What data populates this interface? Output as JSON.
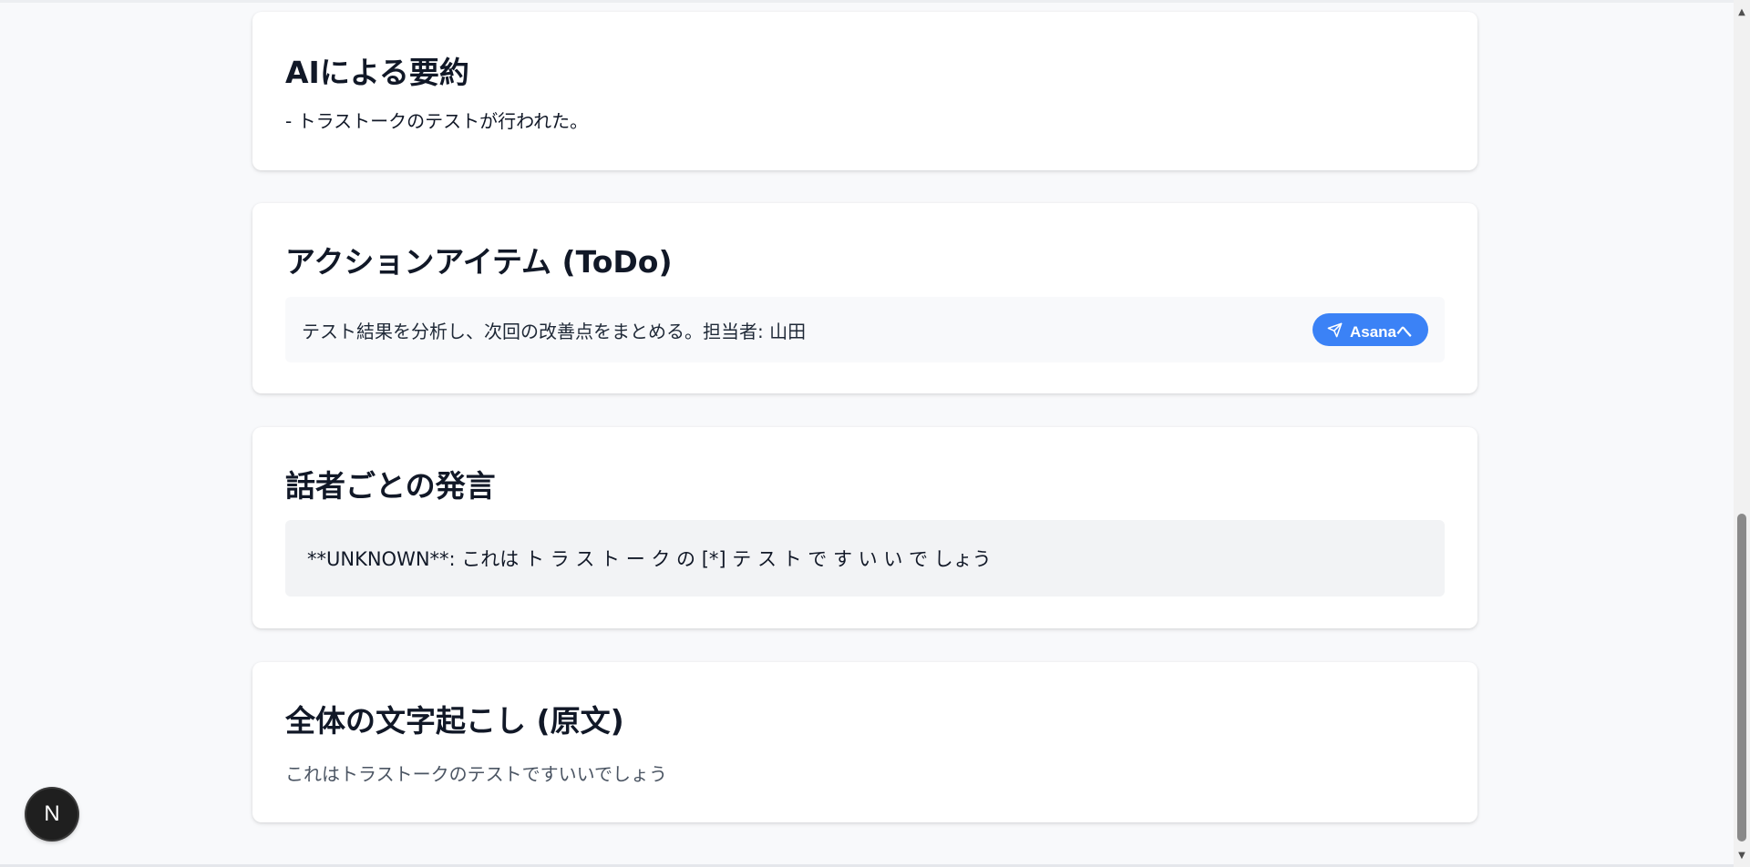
{
  "sections": {
    "summary": {
      "title": "AIによる要約",
      "text": "- トラストークのテストが行われた。"
    },
    "todo": {
      "title": "アクションアイテム (ToDo)",
      "items": [
        {
          "text": "テスト結果を分析し、次回の改善点をまとめる。担当者: 山田",
          "button_label": "Asanaへ",
          "button_icon": "send-icon",
          "button_color": "#3b82f6"
        }
      ]
    },
    "speakers": {
      "title": "話者ごとの発言",
      "utterance": "**UNKNOWN**: これは ト ラ ス ト ー ク の [*] テ ス ト で す い い で しょう"
    },
    "transcript": {
      "title": "全体の文字起こし (原文)",
      "text": "これはトラストークのテストですいいでしょう"
    }
  },
  "badge": {
    "label": "N"
  },
  "scrollbar": {
    "up_arrow": "▲",
    "down_arrow": "▼"
  }
}
